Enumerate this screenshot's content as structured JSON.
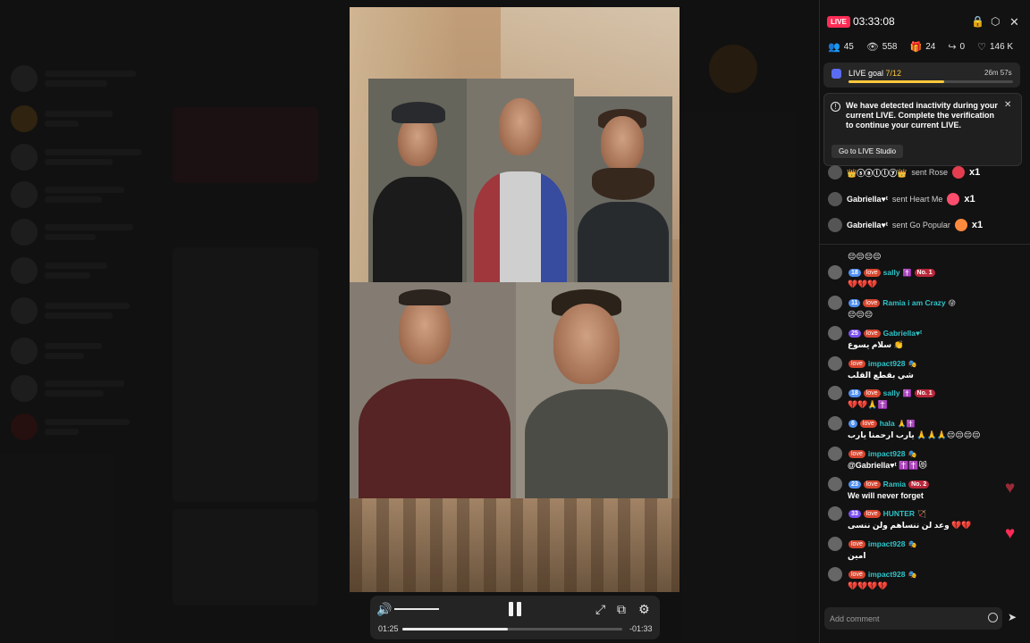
{
  "live": {
    "badge": "LIVE",
    "timer": "03:33:08"
  },
  "header_icons": [
    "lock-icon",
    "settings-hexagon-icon",
    "close-icon"
  ],
  "stats": [
    {
      "icon": "people-icon",
      "glyph": "👥",
      "value": "45"
    },
    {
      "icon": "eye-icon",
      "glyph": "👁",
      "value": "558"
    },
    {
      "icon": "gift-box-icon",
      "glyph": "🎁",
      "value": "24"
    },
    {
      "icon": "share-icon",
      "glyph": "↪",
      "value": "0"
    },
    {
      "icon": "heart-icon",
      "glyph": "♡",
      "value": "146 K"
    }
  ],
  "goal": {
    "label": "LIVE goal",
    "progress": "7/12",
    "fraction": 0.58,
    "time_left": "26m 57s"
  },
  "notice": {
    "text": "We have detected inactivity during your current LIVE. Complete the verification to continue your current LIVE.",
    "button": "Go to LIVE Studio"
  },
  "gifts": [
    {
      "user": "👑ⓢⓐⓛⓛⓨ👑",
      "action": "sent Rose",
      "gift_icon": "rose-gift-icon",
      "color": "#e33d4f",
      "count": "x1"
    },
    {
      "user": "Gabriella♥︎ᵗ",
      "action": "sent Heart Me",
      "gift_icon": "heart-me-gift-icon",
      "color": "#ff4d6d",
      "count": "x1"
    },
    {
      "user": "Gabriella♥︎ᵗ",
      "action": "sent Go Popular",
      "gift_icon": "go-popular-gift-icon",
      "color": "#ff8a3d",
      "count": "x1"
    }
  ],
  "chat": [
    {
      "top_emojis": "😔😔😔😔"
    },
    {
      "level": "18",
      "level_color": "#4f8ff0",
      "fan": "love",
      "name": "sally",
      "badge_extra": "✝️",
      "rank": "No. 1",
      "message": "💔💔💔"
    },
    {
      "level": "11",
      "level_color": "#4f8ff0",
      "fan": "love",
      "name": "Ramia i am Crazy",
      "badge_extra": "😜",
      "rank": "",
      "message": "😔😔😔"
    },
    {
      "level": "25",
      "level_color": "#7a4ff0",
      "fan": "love",
      "name": "Gabriella♥︎ᵗ",
      "badge_extra": "",
      "rank": "",
      "message": "سلام يسوع 👏"
    },
    {
      "level": "",
      "level_color": "#555",
      "fan": "love",
      "name": "impact928",
      "badge_extra": "🎭",
      "rank": "",
      "message": "شي بقطع القلب"
    },
    {
      "level": "18",
      "level_color": "#4f8ff0",
      "fan": "love",
      "name": "sally",
      "badge_extra": "✝️",
      "rank": "No. 1",
      "message": "💔💔🙏✝️"
    },
    {
      "level": "6",
      "level_color": "#4f8ff0",
      "fan": "love",
      "name": "hala",
      "badge_extra": "🙏✝️",
      "rank": "",
      "message": "يارب ارحمنا يارب 🙏🙏🙏😔😔😔😔"
    },
    {
      "level": "",
      "level_color": "#555",
      "fan": "love",
      "name": "impact928",
      "badge_extra": "🎭",
      "rank": "",
      "message": "@Gabriella♥︎ᵗ ✝️✝️😻"
    },
    {
      "level": "23",
      "level_color": "#4f8ff0",
      "fan": "love",
      "name": "Ramia",
      "badge_extra": "",
      "rank": "No. 2",
      "message": "We will never forget"
    },
    {
      "level": "33",
      "level_color": "#7a4ff0",
      "fan": "love",
      "name": "HUNTER",
      "badge_extra": "🏹",
      "rank": "",
      "message": "وعد لن ننساهم ولن ننسى 💔💔"
    },
    {
      "level": "",
      "level_color": "#555",
      "fan": "love",
      "name": "impact928",
      "badge_extra": "🎭",
      "rank": "",
      "message": "امين"
    },
    {
      "level": "",
      "level_color": "#555",
      "fan": "love",
      "name": "impact928",
      "badge_extra": "🎭",
      "rank": "",
      "message": "💔💔💔💔"
    }
  ],
  "comment": {
    "placeholder": "Add comment"
  },
  "player": {
    "elapsed": "01:25",
    "remaining": "-01:33",
    "progress": 0.48,
    "volume": 1.0
  }
}
